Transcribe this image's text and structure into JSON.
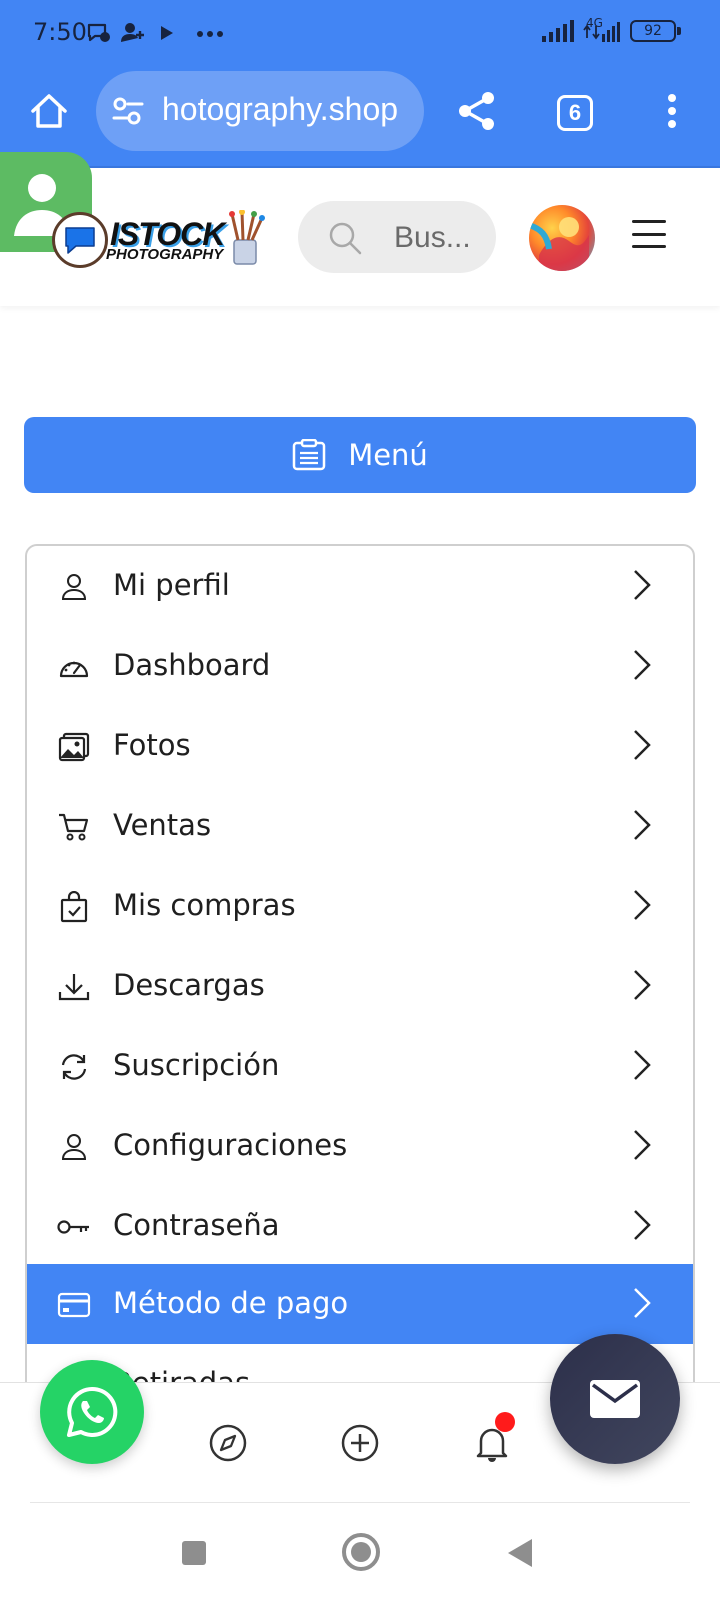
{
  "status_bar": {
    "time": "7:50",
    "network_label": "4G",
    "battery": "92",
    "icons": [
      "message-notification-icon",
      "contact-add-icon",
      "play-icon",
      "more-dots-icon",
      "signal-icon",
      "signal-4g-icon",
      "battery-icon"
    ]
  },
  "browser": {
    "url": "hotography.shop",
    "tab_count": "6",
    "icons": [
      "home-icon",
      "site-settings-icon",
      "share-icon",
      "overflow-menu-icon"
    ]
  },
  "site_header": {
    "logo_title": "ISTOCK",
    "logo_subtitle": "PHOTOGRAPHY",
    "search_placeholder": "Bus..."
  },
  "menu_button": {
    "label": "Menú"
  },
  "menu_items": [
    {
      "label": "Mi perfil",
      "icon": "user-icon",
      "active": false
    },
    {
      "label": "Dashboard",
      "icon": "dashboard-gauge-icon",
      "active": false
    },
    {
      "label": "Fotos",
      "icon": "images-icon",
      "active": false
    },
    {
      "label": "Ventas",
      "icon": "cart-icon",
      "active": false
    },
    {
      "label": "Mis compras",
      "icon": "bag-check-icon",
      "active": false
    },
    {
      "label": "Descargas",
      "icon": "download-icon",
      "active": false
    },
    {
      "label": "Suscripción",
      "icon": "refresh-icon",
      "active": false
    },
    {
      "label": "Configuraciones",
      "icon": "user-settings-icon",
      "active": false
    },
    {
      "label": "Contraseña",
      "icon": "key-icon",
      "active": false
    },
    {
      "label": "Método de pago",
      "icon": "credit-card-icon",
      "active": true
    },
    {
      "label": "Retiradas",
      "icon": "withdrawal-icon",
      "active": false
    }
  ],
  "colors": {
    "accent": "#4285f4",
    "whatsapp": "#25d366",
    "notification_dot": "#ff1b1b",
    "mail_fab": "#2c2f4a"
  }
}
